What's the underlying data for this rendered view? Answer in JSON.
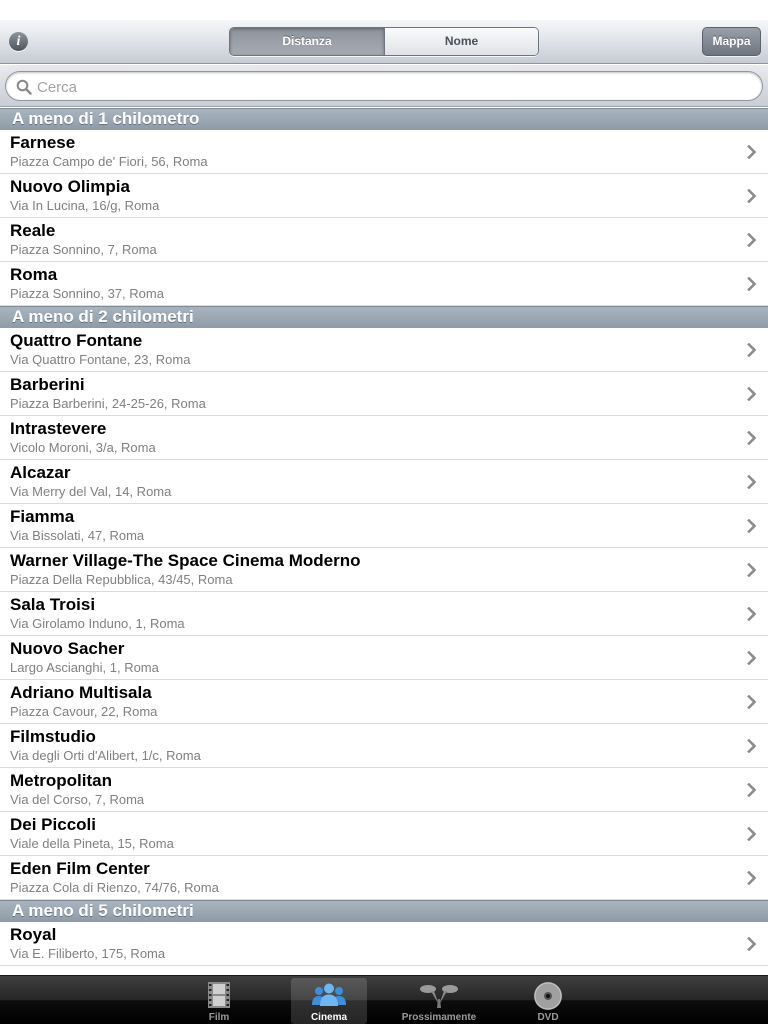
{
  "navbar": {
    "info_icon": "info-icon",
    "segments": [
      {
        "label": "Distanza",
        "selected": true
      },
      {
        "label": "Nome",
        "selected": false
      }
    ],
    "map_button": "Mappa"
  },
  "search": {
    "placeholder": "Cerca",
    "value": "",
    "icon": "magnifier-icon"
  },
  "sections": [
    {
      "title": "A meno di 1 chilometro",
      "items": [
        {
          "name": "Farnese",
          "address": "Piazza Campo de' Fiori, 56, Roma"
        },
        {
          "name": "Nuovo Olimpia",
          "address": "Via In Lucina, 16/g, Roma"
        },
        {
          "name": "Reale",
          "address": "Piazza Sonnino, 7, Roma"
        },
        {
          "name": "Roma",
          "address": "Piazza Sonnino, 37, Roma"
        }
      ]
    },
    {
      "title": "A meno di 2 chilometri",
      "items": [
        {
          "name": "Quattro Fontane",
          "address": "Via Quattro Fontane, 23, Roma"
        },
        {
          "name": "Barberini",
          "address": "Piazza Barberini, 24-25-26, Roma"
        },
        {
          "name": "Intrastevere",
          "address": "Vicolo Moroni, 3/a, Roma"
        },
        {
          "name": "Alcazar",
          "address": "Via Merry del Val, 14, Roma"
        },
        {
          "name": "Fiamma",
          "address": "Via Bissolati, 47, Roma"
        },
        {
          "name": "Warner Village-The Space Cinema Moderno",
          "address": "Piazza Della Repubblica, 43/45, Roma"
        },
        {
          "name": "Sala Troisi",
          "address": "Via Girolamo Induno, 1, Roma"
        },
        {
          "name": "Nuovo Sacher",
          "address": "Largo Ascianghi, 1, Roma"
        },
        {
          "name": "Adriano Multisala",
          "address": "Piazza Cavour, 22, Roma"
        },
        {
          "name": "Filmstudio",
          "address": "Via degli Orti d'Alibert, 1/c, Roma"
        },
        {
          "name": "Metropolitan",
          "address": "Via del Corso, 7, Roma"
        },
        {
          "name": "Dei Piccoli",
          "address": "Viale della Pineta, 15, Roma"
        },
        {
          "name": "Eden Film Center",
          "address": "Piazza Cola di Rienzo, 74/76, Roma"
        }
      ]
    },
    {
      "title": "A meno di 5 chilometri",
      "items": [
        {
          "name": "Royal",
          "address": "Via E. Filiberto, 175, Roma"
        }
      ]
    }
  ],
  "row_accessory_icon": "chevron-right-icon",
  "tabbar": {
    "tabs": [
      {
        "label": "Film",
        "icon": "film-strip-icon",
        "selected": false
      },
      {
        "label": "Cinema",
        "icon": "people-group-icon",
        "selected": true
      },
      {
        "label": "Prossimamente",
        "icon": "spotlight-icon",
        "selected": false
      },
      {
        "label": "DVD",
        "icon": "disc-icon",
        "selected": false
      }
    ]
  },
  "colors": {
    "section_header": "#9aa7b2",
    "selected_segment": "#959ba4",
    "tab_selected_label": "#ffffff",
    "tab_inactive_label": "#9a9a9a",
    "tab_selected_icon": "#4a9ee8"
  }
}
